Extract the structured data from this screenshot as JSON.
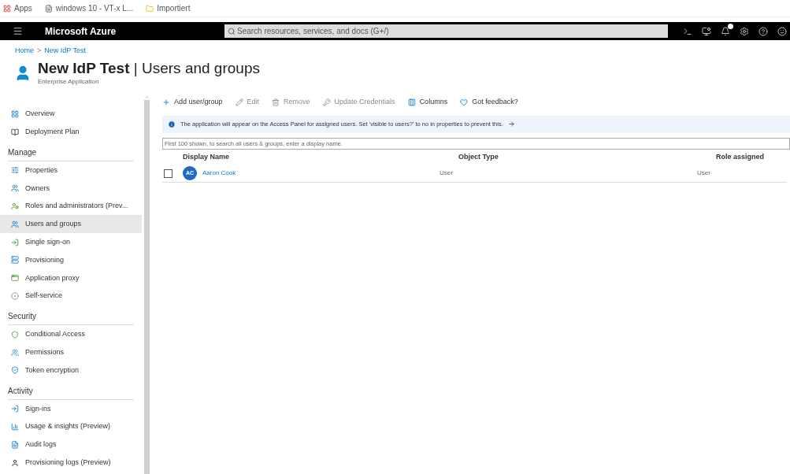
{
  "bookmarks": [
    {
      "label": "Apps"
    },
    {
      "label": "windows 10 - VT-x L..."
    },
    {
      "label": "Importiert"
    }
  ],
  "top_bar": {
    "title": "Microsoft Azure",
    "search": {
      "placeholder": "Search resources, services, and docs (G+/)"
    }
  },
  "breadcrumb": {
    "items": [
      "Home",
      "New IdP Test"
    ],
    "separator": ">"
  },
  "page": {
    "title": "New IdP Test",
    "divider": "|",
    "section": "Users and groups",
    "subtitle": "Enterprise Application"
  },
  "sidebar": {
    "groups": [
      {
        "items": [
          {
            "label": "Overview",
            "selected": false
          },
          {
            "label": "Deployment Plan",
            "selected": false
          }
        ]
      },
      {
        "heading": "Manage",
        "items": [
          {
            "label": "Properties",
            "selected": false
          },
          {
            "label": "Owners",
            "selected": false
          },
          {
            "label": "Roles and administrators (Prev...",
            "selected": false
          },
          {
            "label": "Users and groups",
            "selected": true
          },
          {
            "label": "Single sign-on",
            "selected": false
          },
          {
            "label": "Provisioning",
            "selected": false
          },
          {
            "label": "Application proxy",
            "selected": false
          },
          {
            "label": "Self-service",
            "selected": false
          }
        ]
      },
      {
        "heading": "Security",
        "items": [
          {
            "label": "Conditional Access",
            "selected": false
          },
          {
            "label": "Permissions",
            "selected": false
          },
          {
            "label": "Token encryption",
            "selected": false
          }
        ]
      },
      {
        "heading": "Activity",
        "items": [
          {
            "label": "Sign-ins",
            "selected": false
          },
          {
            "label": "Usage & insights (Preview)",
            "selected": false
          },
          {
            "label": "Audit logs",
            "selected": false
          },
          {
            "label": "Provisioning logs (Preview)",
            "selected": false
          }
        ]
      }
    ]
  },
  "toolbar": [
    {
      "label": "Add user/group",
      "disabled": false
    },
    {
      "label": "Edit",
      "disabled": true
    },
    {
      "label": "Remove",
      "disabled": true
    },
    {
      "label": "Update Credentials",
      "disabled": true
    },
    {
      "label": "Columns",
      "disabled": false
    },
    {
      "label": "Got feedback?",
      "disabled": false
    }
  ],
  "info_banner": "The application will appear on the Access Panel for assigned users. Set 'visible to users?' to no in properties to prevent this.",
  "filter": {
    "placeholder": "First 100 shown, to search all users & groups, enter a display name."
  },
  "table": {
    "columns": [
      "Display Name",
      "Object Type",
      "Role assigned"
    ],
    "rows": [
      {
        "checked": false,
        "initials": "AC",
        "name": "Aaron Cook",
        "object_type": "User",
        "role": "User"
      }
    ]
  }
}
